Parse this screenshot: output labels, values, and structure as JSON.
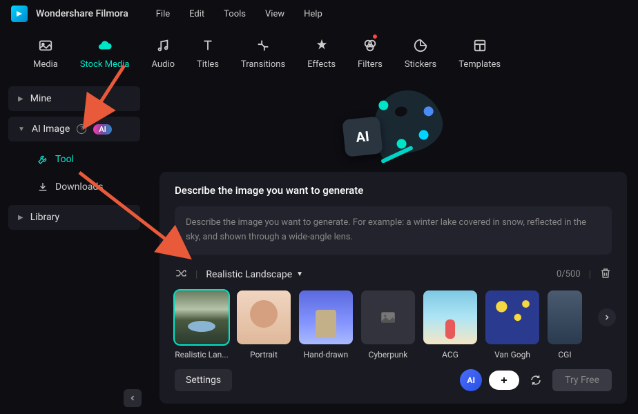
{
  "app": {
    "title": "Wondershare Filmora"
  },
  "menubar": [
    "File",
    "Edit",
    "Tools",
    "View",
    "Help"
  ],
  "toolbar": [
    {
      "id": "media",
      "label": "Media"
    },
    {
      "id": "stock-media",
      "label": "Stock Media",
      "active": true
    },
    {
      "id": "audio",
      "label": "Audio"
    },
    {
      "id": "titles",
      "label": "Titles"
    },
    {
      "id": "transitions",
      "label": "Transitions"
    },
    {
      "id": "effects",
      "label": "Effects"
    },
    {
      "id": "filters",
      "label": "Filters",
      "dot": true
    },
    {
      "id": "stickers",
      "label": "Stickers"
    },
    {
      "id": "templates",
      "label": "Templates"
    }
  ],
  "sidebar": {
    "mine": "Mine",
    "ai_image": "AI Image",
    "ai_badge": "AI",
    "tool": "Tool",
    "downloads": "Downloads",
    "library": "Library"
  },
  "panel": {
    "title": "Describe the image you want to generate",
    "placeholder": "Describe the image you want to generate. For example: a winter lake covered in snow, reflected in the sky, and shown through a wide-angle lens.",
    "style_selected": "Realistic Landscape",
    "char_count": "0/500",
    "styles": [
      {
        "id": "realistic-landscape",
        "label": "Realistic Lan...",
        "selected": true
      },
      {
        "id": "portrait",
        "label": "Portrait"
      },
      {
        "id": "hand-drawn",
        "label": "Hand-drawn"
      },
      {
        "id": "cyberpunk",
        "label": "Cyberpunk",
        "placeholder": true
      },
      {
        "id": "acg",
        "label": "ACG"
      },
      {
        "id": "van-gogh",
        "label": "Van Gogh"
      },
      {
        "id": "cgi",
        "label": "CGI",
        "partial": true
      }
    ],
    "settings": "Settings",
    "try_free": "Try Free",
    "ai_btn": "AI"
  }
}
